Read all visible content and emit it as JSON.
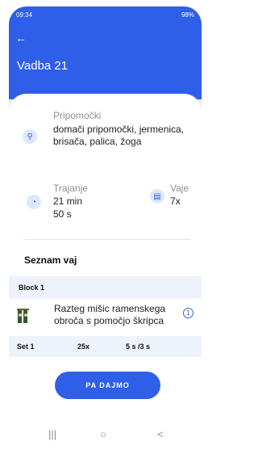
{
  "status": {
    "time": "09:34",
    "right": "98%"
  },
  "header": {
    "back_icon": "arrow-left-icon",
    "title": "Vadba 21"
  },
  "details": {
    "equipment": {
      "label": "Pripomočki",
      "value": "domači pripomočki, jermenica, brisača, palica, žoga"
    },
    "duration": {
      "label": "Trajanje",
      "value_line1": "21 min",
      "value_line2": "50 s"
    },
    "exercises": {
      "label": "Vaje",
      "value": "7x"
    }
  },
  "section": {
    "title": "Seznam vaj"
  },
  "block": {
    "label": "Block 1"
  },
  "exercise": {
    "name": "Razteg mišic ramenskega obroča s pomočjo škripca"
  },
  "set": {
    "set": "Set 1",
    "reps": "25x",
    "time": "5 s /3 s"
  },
  "cta": {
    "label": "PA DAJMO"
  },
  "navbar": {
    "recent": "|||",
    "home": "○",
    "back": "<"
  },
  "colors": {
    "primary": "#2f5ee9",
    "background": "#e9ecf5"
  }
}
